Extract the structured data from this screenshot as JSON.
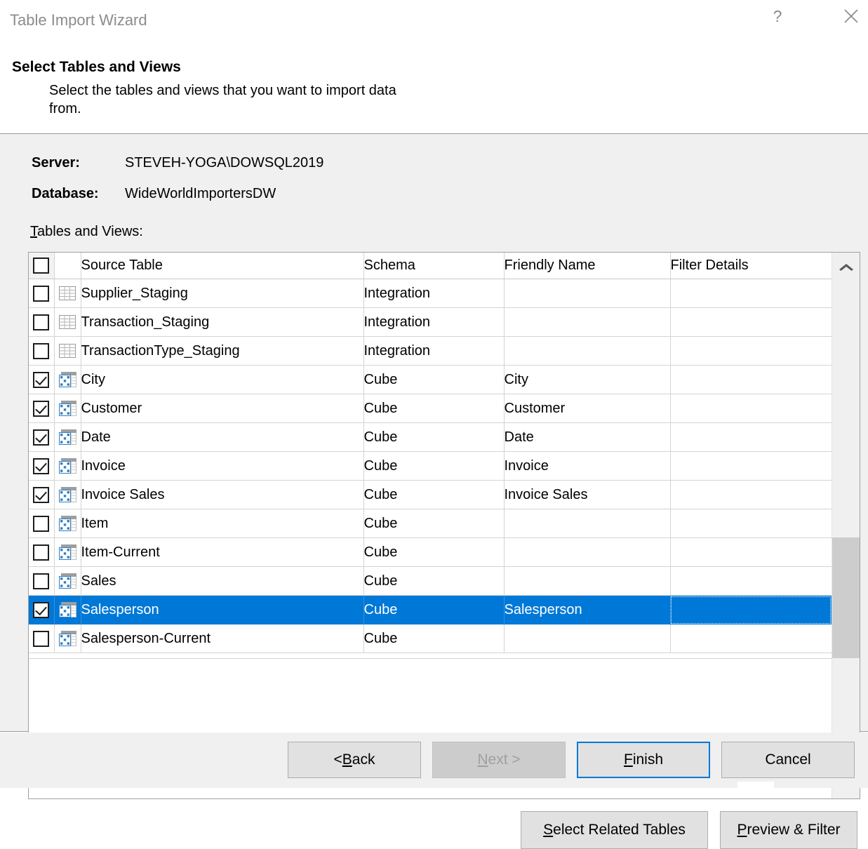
{
  "window": {
    "title": "Table Import Wizard",
    "help_icon": "question-mark-icon",
    "close_icon": "close-icon"
  },
  "header": {
    "title": "Select Tables and Views",
    "subtitle": "Select the tables and views that you want to import data from."
  },
  "connection": {
    "server_label": "Server:",
    "server_value": "STEVEH-YOGA\\DOWSQL2019",
    "database_label": "Database:",
    "database_value": "WideWorldImportersDW"
  },
  "list": {
    "caption_accel": "T",
    "caption_rest": "ables and Views:",
    "columns": {
      "source_table": "Source Table",
      "schema": "Schema",
      "friendly_name": "Friendly Name",
      "filter_details": "Filter Details"
    },
    "select_all_checked": false,
    "rows": [
      {
        "checked": false,
        "icon": "table-icon",
        "source_table": "Supplier_Staging",
        "schema": "Integration",
        "friendly_name": "",
        "filter_details": "",
        "selected": false
      },
      {
        "checked": false,
        "icon": "table-icon",
        "source_table": "Transaction_Staging",
        "schema": "Integration",
        "friendly_name": "",
        "filter_details": "",
        "selected": false
      },
      {
        "checked": false,
        "icon": "table-icon",
        "source_table": "TransactionType_Staging",
        "schema": "Integration",
        "friendly_name": "",
        "filter_details": "",
        "selected": false
      },
      {
        "checked": true,
        "icon": "view-icon",
        "source_table": "City",
        "schema": "Cube",
        "friendly_name": "City",
        "filter_details": "",
        "selected": false
      },
      {
        "checked": true,
        "icon": "view-icon",
        "source_table": "Customer",
        "schema": "Cube",
        "friendly_name": "Customer",
        "filter_details": "",
        "selected": false
      },
      {
        "checked": true,
        "icon": "view-icon",
        "source_table": "Date",
        "schema": "Cube",
        "friendly_name": "Date",
        "filter_details": "",
        "selected": false
      },
      {
        "checked": true,
        "icon": "view-icon",
        "source_table": "Invoice",
        "schema": "Cube",
        "friendly_name": "Invoice",
        "filter_details": "",
        "selected": false
      },
      {
        "checked": true,
        "icon": "view-icon",
        "source_table": "Invoice Sales",
        "schema": "Cube",
        "friendly_name": "Invoice Sales",
        "filter_details": "",
        "selected": false
      },
      {
        "checked": false,
        "icon": "view-icon",
        "source_table": "Item",
        "schema": "Cube",
        "friendly_name": "",
        "filter_details": "",
        "selected": false
      },
      {
        "checked": false,
        "icon": "view-icon",
        "source_table": "Item-Current",
        "schema": "Cube",
        "friendly_name": "",
        "filter_details": "",
        "selected": false
      },
      {
        "checked": false,
        "icon": "view-icon",
        "source_table": "Sales",
        "schema": "Cube",
        "friendly_name": "",
        "filter_details": "",
        "selected": false
      },
      {
        "checked": true,
        "icon": "view-icon",
        "source_table": "Salesperson",
        "schema": "Cube",
        "friendly_name": "Salesperson",
        "filter_details": "",
        "selected": true
      },
      {
        "checked": false,
        "icon": "view-icon",
        "source_table": "Salesperson-Current",
        "schema": "Cube",
        "friendly_name": "",
        "filter_details": "",
        "selected": false
      }
    ],
    "scrollbar": {
      "up_icon": "chevron-up-icon",
      "down_icon": "chevron-down-icon"
    }
  },
  "actions": {
    "select_related_accel": "S",
    "select_related_rest": "elect Related Tables",
    "preview_filter_accel": "P",
    "preview_filter_rest": "review & Filter"
  },
  "footer": {
    "back_pre": "< ",
    "back_accel": "B",
    "back_rest": "ack",
    "next_accel": "N",
    "next_rest": "ext >",
    "next_disabled": true,
    "finish_accel": "F",
    "finish_rest": "inish",
    "finish_default": true,
    "cancel": "Cancel"
  },
  "colors": {
    "selection_blue": "#0078d7",
    "body_gray": "#f0f0f0",
    "button_face": "#e1e1e1",
    "disabled_face": "#cccccc",
    "icon_blue": "#2f7fc4"
  }
}
